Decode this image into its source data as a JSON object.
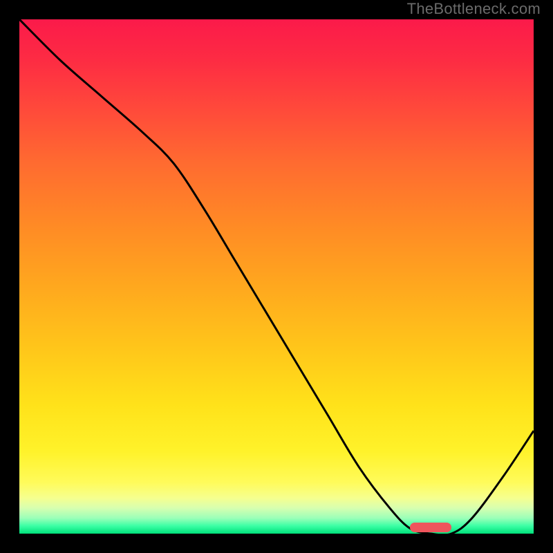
{
  "watermark": {
    "text": "TheBottleneck.com"
  },
  "colors": {
    "frame_bg": "#000000",
    "line": "#000000",
    "marker": "#ef555c",
    "gradient_top": "#fb1a4a",
    "gradient_bottom": "#00e07a"
  },
  "chart_data": {
    "type": "line",
    "title": "",
    "xlabel": "",
    "ylabel": "",
    "xlim": [
      0,
      100
    ],
    "ylim": [
      0,
      100
    ],
    "grid": false,
    "legend": false,
    "background": "vertical-gradient red→yellow→green (bottleneck heatmap)",
    "series": [
      {
        "name": "bottleneck-curve",
        "x": [
          0,
          8,
          16,
          24,
          30,
          36,
          42,
          48,
          54,
          60,
          66,
          72,
          76,
          80,
          84,
          88,
          94,
          100
        ],
        "y": [
          100,
          92,
          85,
          78,
          72,
          63,
          53,
          43,
          33,
          23,
          13,
          5,
          1,
          0,
          0,
          3,
          11,
          20
        ]
      }
    ],
    "annotations": [
      {
        "name": "optimal-marker",
        "x_start": 76,
        "x_end": 84,
        "y": 0,
        "color": "#ef555c"
      }
    ]
  }
}
